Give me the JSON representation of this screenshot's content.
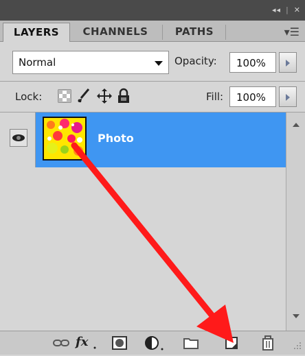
{
  "tabs": [
    {
      "label": "LAYERS",
      "active": true
    },
    {
      "label": "CHANNELS",
      "active": false
    },
    {
      "label": "PATHS",
      "active": false
    }
  ],
  "titlebar": {
    "collapse": "◂◂",
    "close": "✕"
  },
  "blend_mode": {
    "value": "Normal"
  },
  "opacity": {
    "label": "Opacity:",
    "value": "100%"
  },
  "lock": {
    "label": "Lock:"
  },
  "fill": {
    "label": "Fill:",
    "value": "100%"
  },
  "layers": [
    {
      "name": "Photo",
      "visible": true,
      "selected": true
    }
  ],
  "footer_icons": [
    "link-icon",
    "fx-icon",
    "mask-icon",
    "adjustment-icon",
    "group-folder-icon",
    "new-layer-icon",
    "trash-icon"
  ],
  "colors": {
    "selection": "#3f96f2",
    "arrow": "#ff1a1a",
    "panel": "#d6d6d6"
  }
}
